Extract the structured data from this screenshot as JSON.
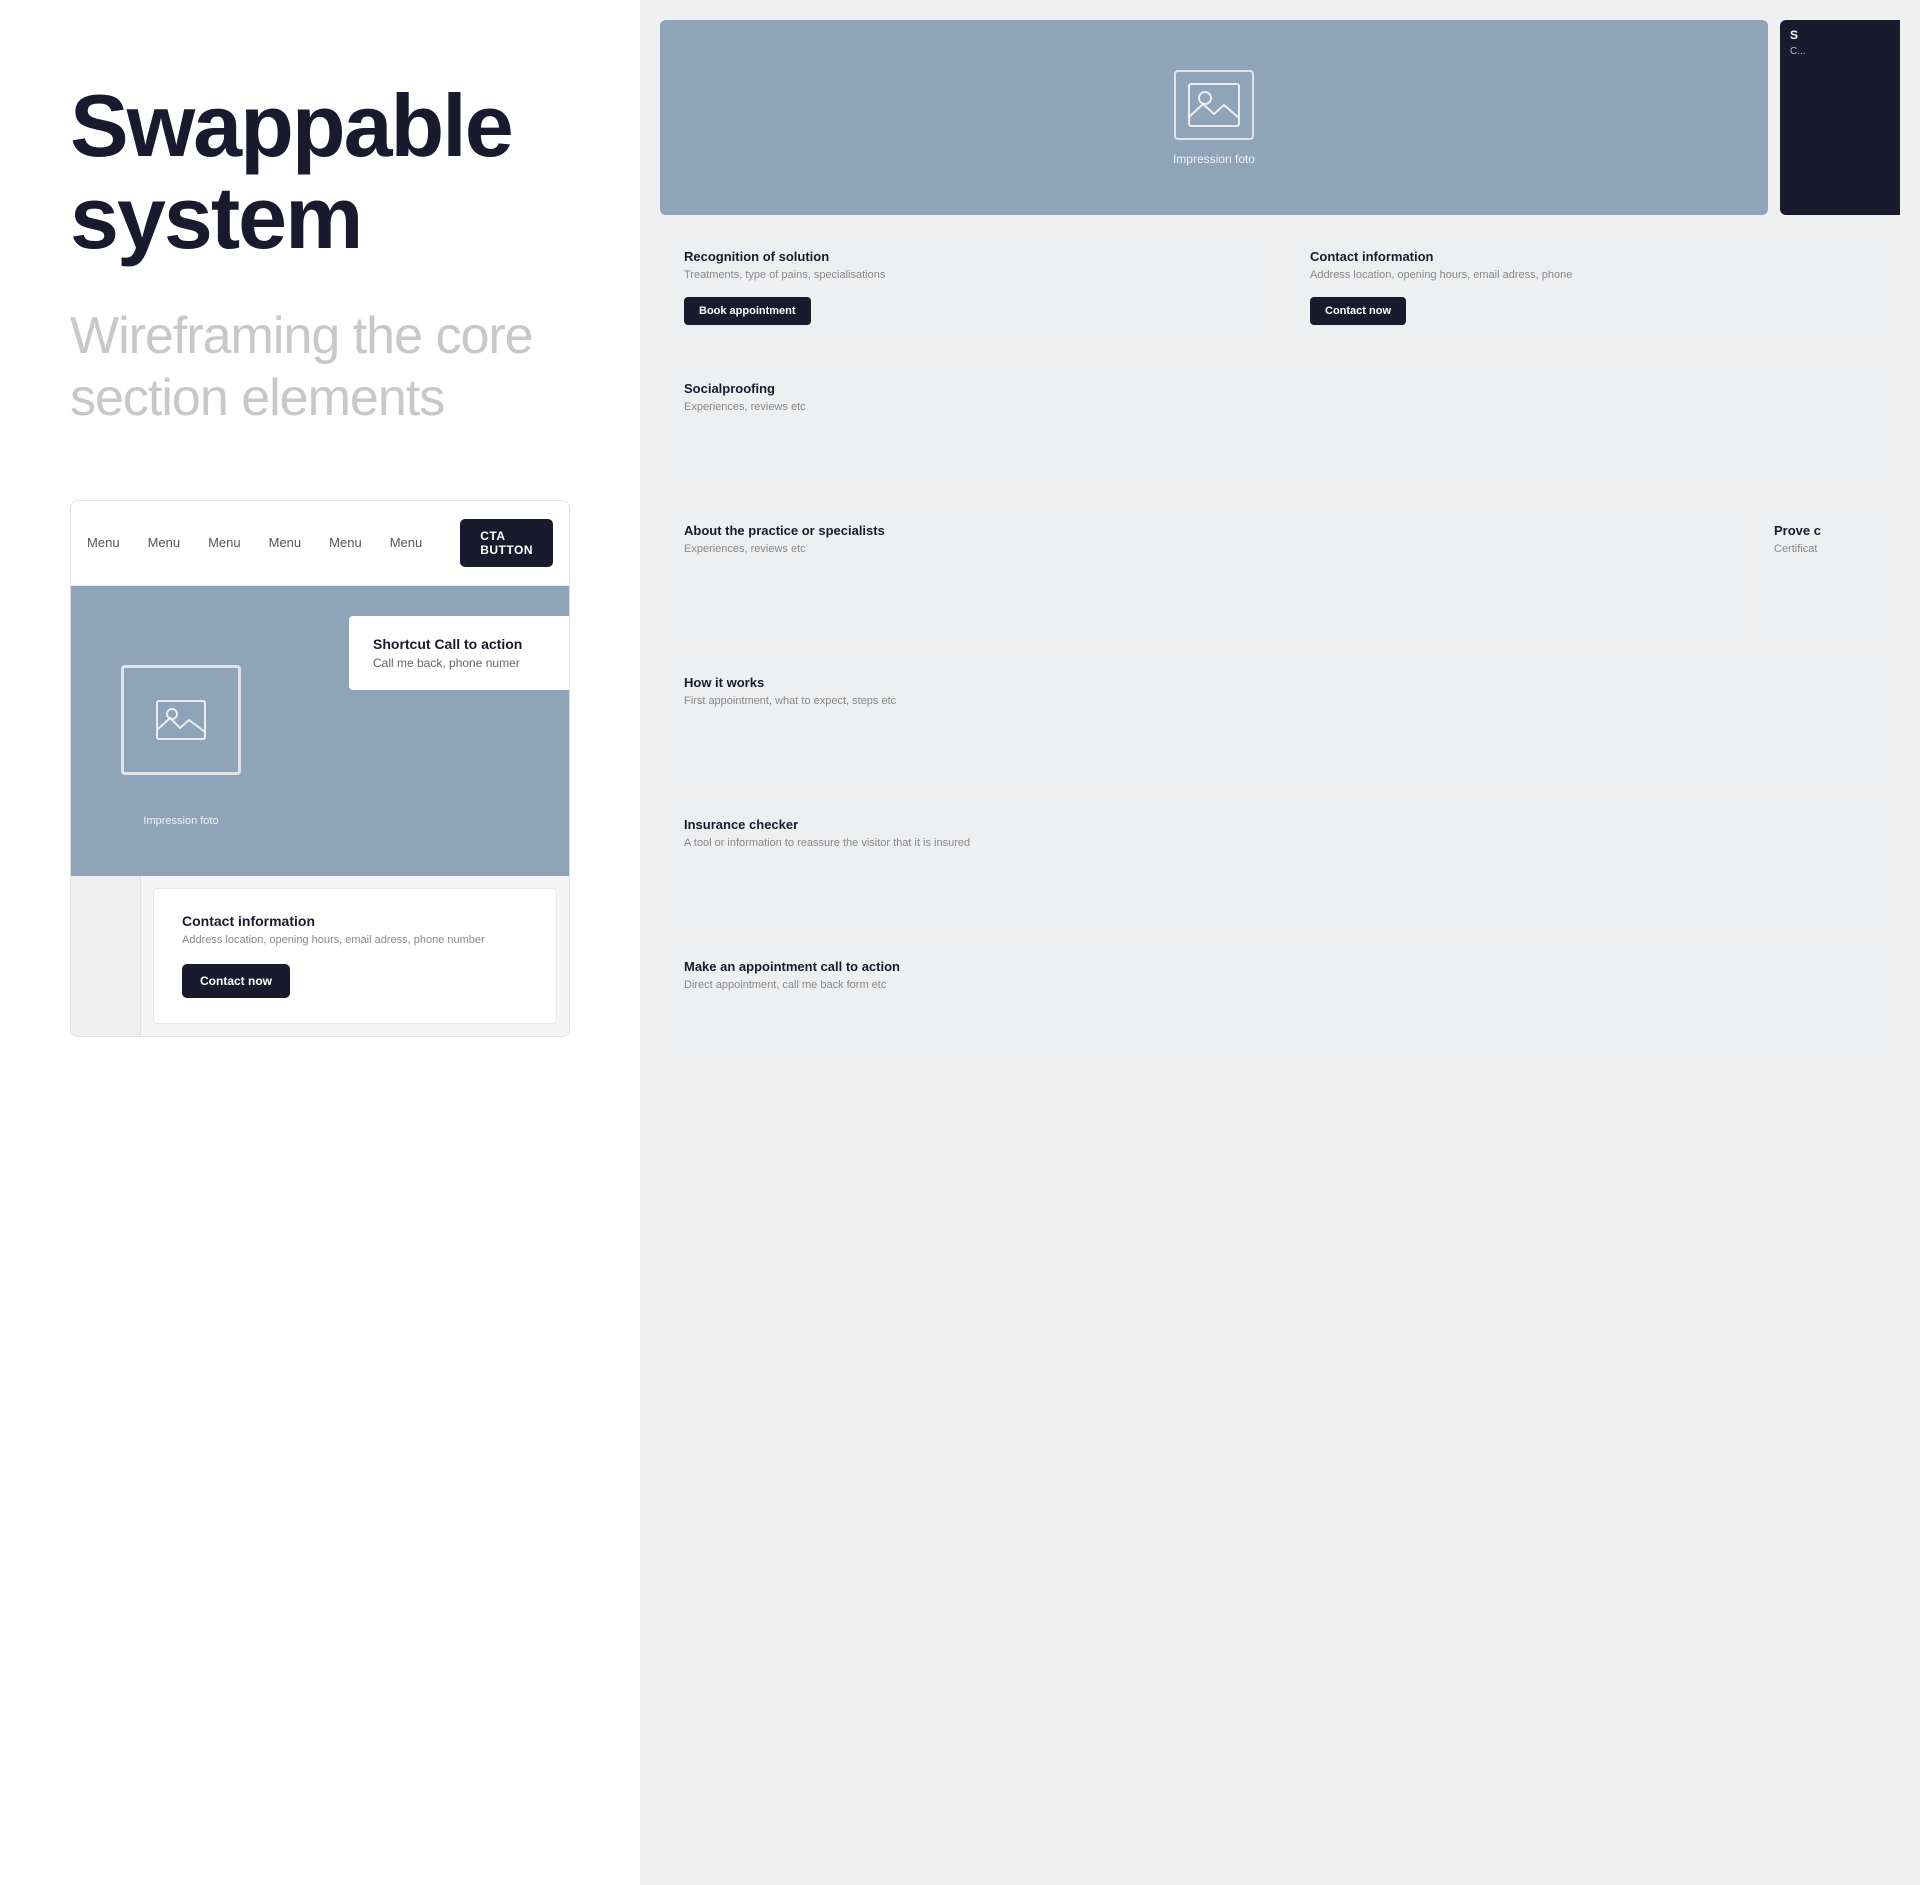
{
  "left": {
    "hero_title": "Swappable system",
    "hero_subtitle": "Wireframing the core section elements",
    "navbar": {
      "items": [
        "Menu",
        "Menu",
        "Menu",
        "Menu",
        "Menu",
        "Menu"
      ],
      "cta_label": "CTA BUTTON"
    },
    "hero_section": {
      "impression_label": "Impression foto"
    },
    "shortcut": {
      "title": "Shortcut Call to action",
      "subtitle": "Call me back, phone numer"
    },
    "contact_card": {
      "title": "Contact information",
      "desc": "Address location, opening hours, email adress, phone number",
      "btn_label": "Contact now"
    }
  },
  "right": {
    "hero": {
      "impression_label": "Impression foto"
    },
    "partial_top": {
      "label": "S",
      "sublabel": "C..."
    },
    "cards": [
      {
        "id": "recognition",
        "title": "Recognition of solution",
        "desc": "Treatments, type of pains, specialisations",
        "btn_label": "Book appointment"
      },
      {
        "id": "contact-info",
        "title": "Contact information",
        "desc": "Address location, opening hours, email adress, phone",
        "btn_label": "Contact now"
      }
    ],
    "socialproofing": {
      "title": "Socialproofing",
      "desc": "Experiences, reviews etc"
    },
    "about": {
      "title": "About the practice or specialists",
      "desc": "Experiences, reviews etc"
    },
    "prove": {
      "title": "Prove c",
      "desc": "Certificat"
    },
    "how_it_works": {
      "title": "How it works",
      "desc": "First appointment, what to expect, steps etc"
    },
    "insurance": {
      "title": "Insurance checker",
      "desc": "A tool or information to reassure the visitor that it is insured"
    },
    "appointment": {
      "title": "Make an appointment call to action",
      "desc": "Direct appointment, call me back form etc"
    }
  },
  "icons": {
    "image_placeholder": "🖼"
  }
}
